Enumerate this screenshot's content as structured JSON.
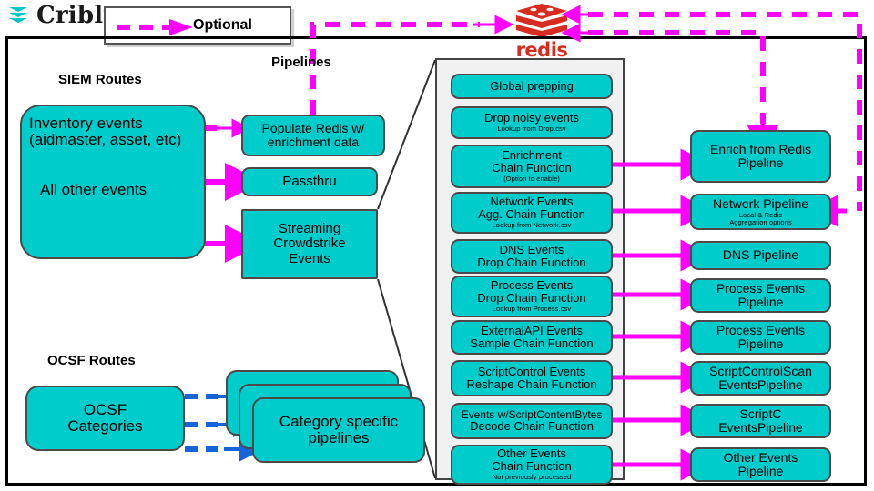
{
  "brand": {
    "logo_text": "Cribl",
    "logo_icon": "cribl-chevrons-icon"
  },
  "legend": {
    "label": "Optional",
    "line_style": "dashed-magenta-arrow",
    "color": "#FF00FF"
  },
  "headings": {
    "siem_routes": "SIEM Routes",
    "pipelines": "Pipelines",
    "ocsf_routes": "OCSF Routes"
  },
  "redis": {
    "label": "redis",
    "icon": "redis-stack-icon",
    "color": "#d82c20"
  },
  "colors": {
    "box_fill": "#00CCCC",
    "box_stroke": "#4a4a4a",
    "optional_flow": "#FF00FF",
    "ocsf_flow": "#1565D8",
    "panel_fill": "#f1f1f1"
  },
  "routes": {
    "siem": {
      "line1": "Inventory events",
      "line2": "(aidmaster, asset, etc)",
      "line3": "All other events"
    },
    "ocsf": {
      "line1": "OCSF",
      "line2": "Categories"
    }
  },
  "siem_pipelines": [
    {
      "line1": "Populate Redis w/",
      "line2": "enrichment data"
    },
    {
      "line1": "Passthru",
      "line2": ""
    },
    {
      "line1": "Streaming",
      "line2": "Crowdstrike",
      "line3": "Events"
    }
  ],
  "ocsf_pipelines": {
    "line1": "Category specific",
    "line2": "pipelines",
    "card_count": 3
  },
  "chain_functions": [
    {
      "line1": "Global prepping",
      "line2": "",
      "sub": ""
    },
    {
      "line1": "Drop noisy events",
      "line2": "",
      "sub": "Lookup from Drop.csv"
    },
    {
      "line1": "Enrichment",
      "line2": "Chain Function",
      "sub": "(Option to enable)"
    },
    {
      "line1": "Network Events",
      "line2": "Agg. Chain Function",
      "sub": "Lookup from Network.csv"
    },
    {
      "line1": "DNS Events",
      "line2": "Drop Chain Function",
      "sub": ""
    },
    {
      "line1": "Process Events",
      "line2": "Drop Chain Function",
      "sub": "Lookup from Process.csv"
    },
    {
      "line1": "ExternalAPI Events",
      "line2": "Sample Chain Function",
      "sub": ""
    },
    {
      "line1": "ScriptControl Events",
      "line2": "Reshape Chain Function",
      "sub": ""
    },
    {
      "line1": "Events w/ScriptContentBytes",
      "line2": "Decode Chain Function",
      "sub": ""
    },
    {
      "line1": "Other Events",
      "line2": "Chain Function",
      "sub": "Not previously processed"
    }
  ],
  "target_pipelines": [
    {
      "line1": "Enrich from Redis",
      "line2": "Pipeline",
      "sub": ""
    },
    {
      "line1": "Network Pipeline",
      "line2": "",
      "sub": "Local & Redis",
      "sub2": "Aggregation options"
    },
    {
      "line1": "DNS Pipeline",
      "line2": "",
      "sub": ""
    },
    {
      "line1": "Process Events",
      "line2": "Pipeline",
      "sub": ""
    },
    {
      "line1": "Process Events",
      "line2": "Pipeline",
      "sub": ""
    },
    {
      "line1": "ScriptControlScan",
      "line2": "EventsPipeline",
      "sub": ""
    },
    {
      "line1": "ScriptC",
      "line2": "EventsPipeline",
      "sub": ""
    },
    {
      "line1": "Other Events",
      "line2": "Pipeline",
      "sub": ""
    }
  ]
}
